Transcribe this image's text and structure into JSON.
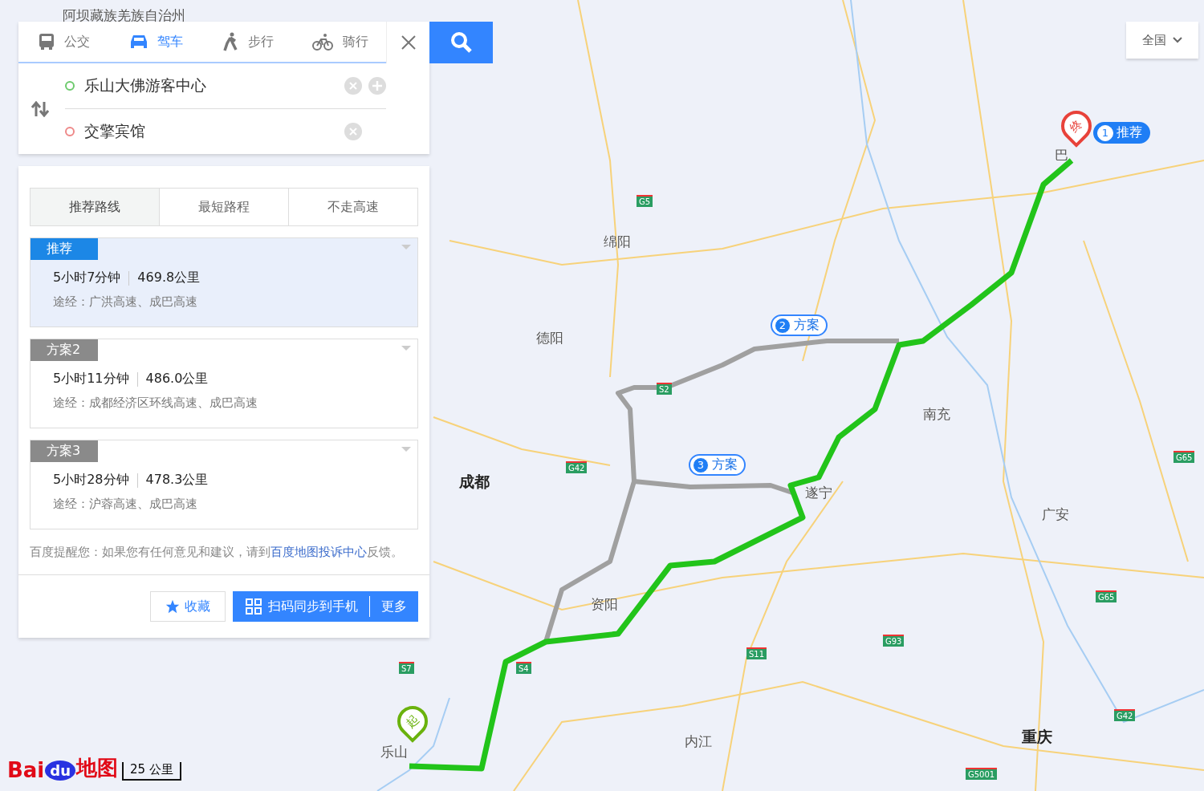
{
  "modes": [
    {
      "label": "公交",
      "kind": "bus",
      "selected": false
    },
    {
      "label": "驾车",
      "kind": "car",
      "selected": true
    },
    {
      "label": "步行",
      "kind": "walk",
      "selected": false
    },
    {
      "label": "骑行",
      "kind": "bike",
      "selected": false
    }
  ],
  "route_inputs": {
    "start": "乐山大佛游客中心",
    "end": "交擎宾馆"
  },
  "strategy_tabs": [
    {
      "label": "推荐路线",
      "selected": true
    },
    {
      "label": "最短路程",
      "selected": false
    },
    {
      "label": "不走高速",
      "selected": false
    }
  ],
  "routes": [
    {
      "badge": "推荐",
      "selected": true,
      "duration": "5小时7分钟",
      "distance": "469.8公里",
      "via": "途经：广洪高速、成巴高速"
    },
    {
      "badge": "方案2",
      "selected": false,
      "duration": "5小时11分钟",
      "distance": "486.0公里",
      "via": "途经：成都经济区环线高速、成巴高速"
    },
    {
      "badge": "方案3",
      "selected": false,
      "duration": "5小时28分钟",
      "distance": "478.3公里",
      "via": "途经：沪蓉高速、成巴高速"
    }
  ],
  "notice": {
    "text": "百度提醒您：如果您有任何意见和建议，请到",
    "link": "百度地图投诉中心",
    "text_end": "反馈。"
  },
  "actions": {
    "favorite": "收藏",
    "sync": "扫码同步到手机",
    "more": "更多"
  },
  "region_selector": "全国",
  "map": {
    "places": [
      {
        "name": "阿坝藏族羌族自治州",
        "major": false
      },
      {
        "name": "巴",
        "major": false
      },
      {
        "name": "绵阳",
        "major": false
      },
      {
        "name": "德阳",
        "major": false
      },
      {
        "name": "南充",
        "major": false
      },
      {
        "name": "成都",
        "major": true
      },
      {
        "name": "遂宁",
        "major": false
      },
      {
        "name": "广安",
        "major": false
      },
      {
        "name": "资阳",
        "major": false
      },
      {
        "name": "乐山",
        "major": false
      },
      {
        "name": "内江",
        "major": false
      },
      {
        "name": "重庆",
        "major": true
      }
    ],
    "road_shields": [
      "G5",
      "S2",
      "G42",
      "S4",
      "S7",
      "S11",
      "G93",
      "G65",
      "G65",
      "G42",
      "G5001"
    ],
    "route_callouts": [
      {
        "number": "1",
        "label": "推荐",
        "selected": true
      },
      {
        "number": "2",
        "label": "方案",
        "selected": false
      },
      {
        "number": "3",
        "label": "方案",
        "selected": false
      }
    ],
    "start_marker": "起",
    "end_marker": "终",
    "scale": "25 公里",
    "logo": {
      "part1": "Bai",
      "part2": "du",
      "part3": "地图"
    }
  }
}
